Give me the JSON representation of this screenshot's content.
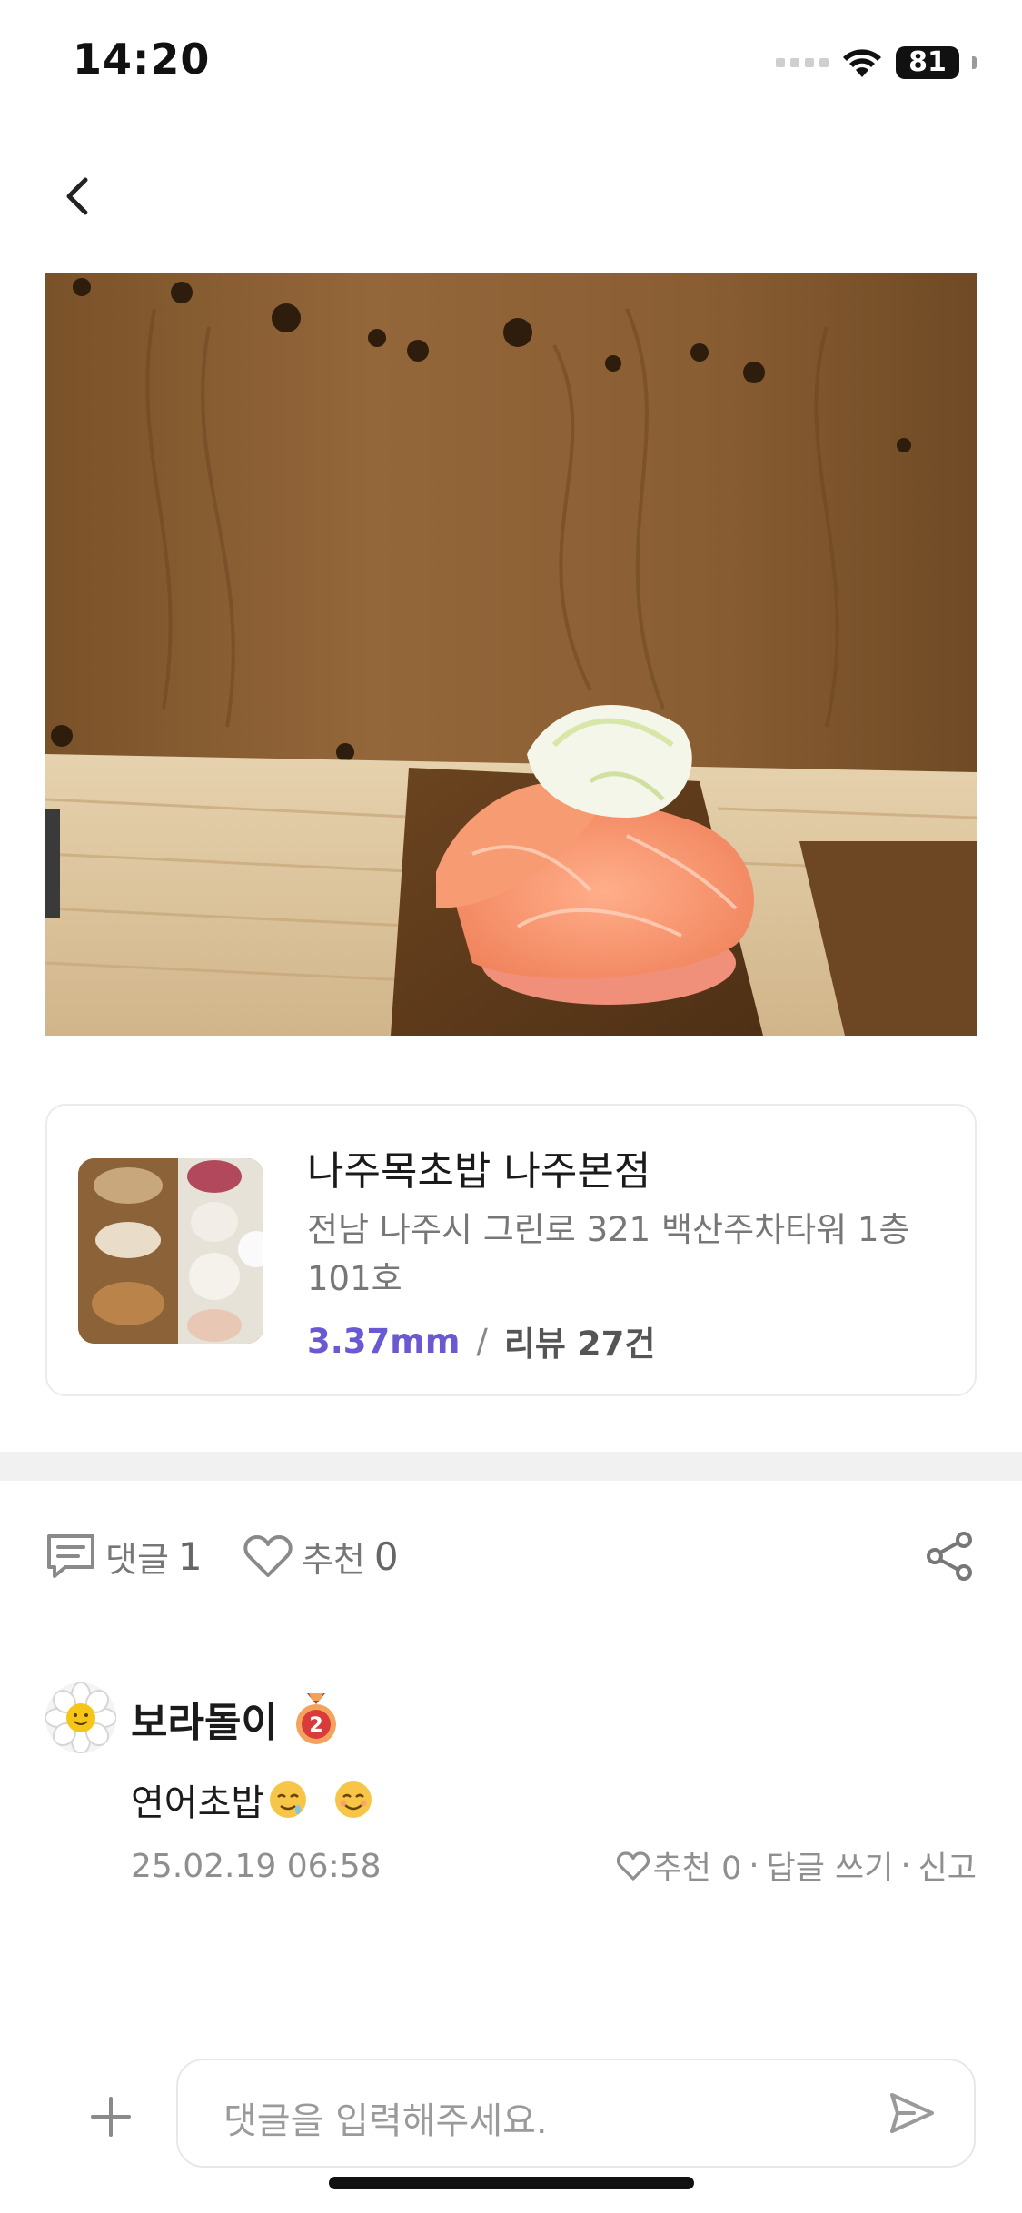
{
  "status_bar": {
    "time": "14:20",
    "battery": "81"
  },
  "store": {
    "name": "나주목초밥 나주본점",
    "address": "전남 나주시 그린로 321 백산주차타워 1층 101호",
    "rating": "3.37mm",
    "separator": "/",
    "reviews": "리뷰 27건"
  },
  "actions": {
    "comment_label": "댓글",
    "comment_count": "1",
    "like_label": "추천",
    "like_count": "0"
  },
  "comments": [
    {
      "author": "보라돌이",
      "rank": "2",
      "text": "연어초밥",
      "date": "25.02.19 06:58",
      "like_label": "추천 0",
      "reply_label": "답글 쓰기",
      "report_label": "신고"
    }
  ],
  "input": {
    "placeholder": "댓글을 입력해주세요."
  },
  "colors": {
    "accent": "#6a5ad1",
    "divider": "#f1f1f2",
    "muted": "#8f8f8f"
  }
}
